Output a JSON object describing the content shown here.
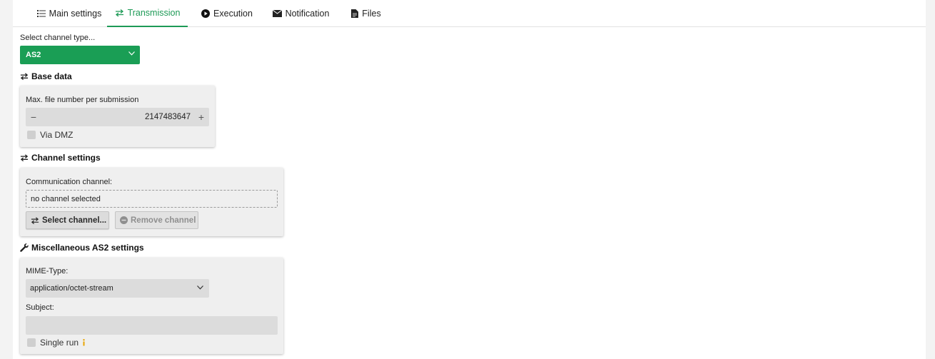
{
  "tabs": [
    {
      "label": "Main settings",
      "icon": "list-icon"
    },
    {
      "label": "Transmission",
      "icon": "transfer-icon",
      "active": true
    },
    {
      "label": "Execution",
      "icon": "play-icon"
    },
    {
      "label": "Notification",
      "icon": "mail-icon"
    },
    {
      "label": "Files",
      "icon": "file-icon"
    }
  ],
  "channel_type": {
    "label": "Select channel type...",
    "value": "AS2"
  },
  "base_data": {
    "title": "Base data",
    "max_files_label": "Max. file number per submission",
    "max_files_value": "2147483647",
    "minus": "−",
    "plus": "+",
    "via_dmz_label": "Via DMZ"
  },
  "channel_settings": {
    "title": "Channel settings",
    "comm_label": "Communication channel:",
    "comm_value": "no channel selected",
    "select_button": "Select channel...",
    "remove_button": "Remove channel"
  },
  "misc": {
    "title": "Miscellaneous AS2 settings",
    "mime_label": "MIME-Type:",
    "mime_value": "application/octet-stream",
    "subject_label": "Subject:",
    "subject_value": "",
    "single_run_label": "Single run"
  },
  "colors": {
    "accent": "#1d9a56",
    "select_green": "#1a9e55",
    "info": "#e8a400"
  }
}
